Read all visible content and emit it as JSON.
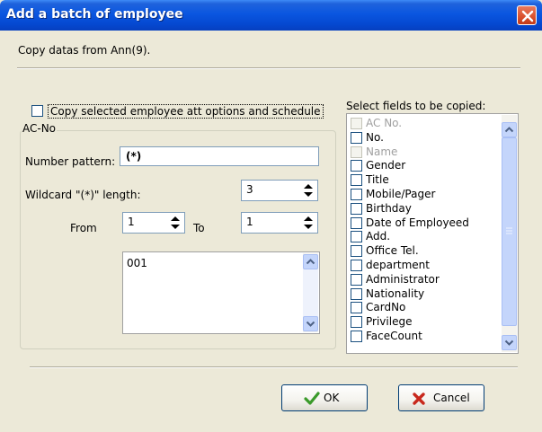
{
  "window": {
    "title": "Add a batch of employee"
  },
  "header": {
    "copy_from": "Copy datas from Ann(9)."
  },
  "options": {
    "copy_option_label": "Copy selected employee att options and schedule"
  },
  "acno": {
    "group_label": "AC-No",
    "number_pattern_label": "Number pattern:",
    "number_pattern_value": "(*)",
    "wildcard_label": "Wildcard \"(*)\" length:",
    "wildcard_value": "3",
    "from_label": "From",
    "from_value": "1",
    "to_label": "To",
    "to_value": "1",
    "preview_items": [
      "001"
    ]
  },
  "fields": {
    "label": "Select fields to be copied:",
    "items": [
      {
        "label": "AC No.",
        "enabled": false
      },
      {
        "label": "No.",
        "enabled": true
      },
      {
        "label": "Name",
        "enabled": false
      },
      {
        "label": "Gender",
        "enabled": true
      },
      {
        "label": "Title",
        "enabled": true
      },
      {
        "label": "Mobile/Pager",
        "enabled": true
      },
      {
        "label": "Birthday",
        "enabled": true
      },
      {
        "label": "Date of Employeed",
        "enabled": true
      },
      {
        "label": "Add.",
        "enabled": true
      },
      {
        "label": "Office Tel.",
        "enabled": true
      },
      {
        "label": "department",
        "enabled": true
      },
      {
        "label": "Administrator",
        "enabled": true
      },
      {
        "label": "Nationality",
        "enabled": true
      },
      {
        "label": "CardNo",
        "enabled": true
      },
      {
        "label": "Privilege",
        "enabled": true
      },
      {
        "label": "FaceCount",
        "enabled": true
      }
    ]
  },
  "buttons": {
    "ok_label": "OK",
    "cancel_label": "Cancel"
  },
  "colors": {
    "title_bar": "#0a56e0",
    "dialog_bg": "#ece9d8",
    "ok_check": "#3a9a2a",
    "cancel_x": "#c8281c"
  },
  "icons": {
    "close": "close-icon",
    "ok": "checkmark-icon",
    "cancel": "x-icon"
  }
}
